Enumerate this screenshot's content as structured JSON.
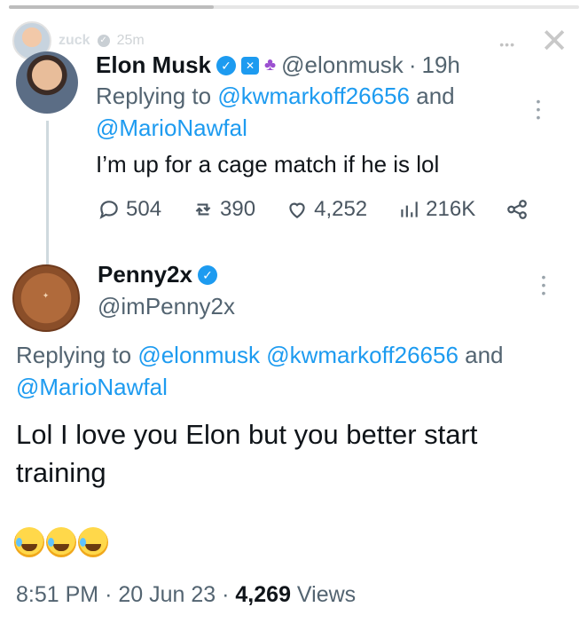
{
  "story": {
    "owner": "zuck",
    "age": "25m"
  },
  "tweet1": {
    "display_name": "Elon Musk",
    "handle": "@elonmusk",
    "separator": "·",
    "time": "19h",
    "replying_prefix": "Replying to",
    "mention1": "@kwmarkoff26656",
    "and": "and",
    "mention2": "@MarioNawfal",
    "text": "I’m up for a cage match if he is lol",
    "actions": {
      "replies": "504",
      "reposts": "390",
      "likes": "4,252",
      "views": "216K"
    }
  },
  "tweet2": {
    "display_name": "Penny2x",
    "handle": "@imPenny2x",
    "replying_prefix": "Replying to",
    "mention1": "@elonmusk",
    "mention2": "@kwmarkoff26656",
    "and": "and",
    "mention3": "@MarioNawfal",
    "text": "Lol I love you Elon but you better start training",
    "meta_time": "8:51 PM",
    "meta_sep1": "·",
    "meta_date": "20 Jun 23",
    "meta_sep2": "·",
    "meta_views_count": "4,269",
    "meta_views_label": "Views"
  },
  "colors": {
    "accent": "#1d9bf0",
    "text": "#0f1419",
    "secondary": "#536471"
  }
}
